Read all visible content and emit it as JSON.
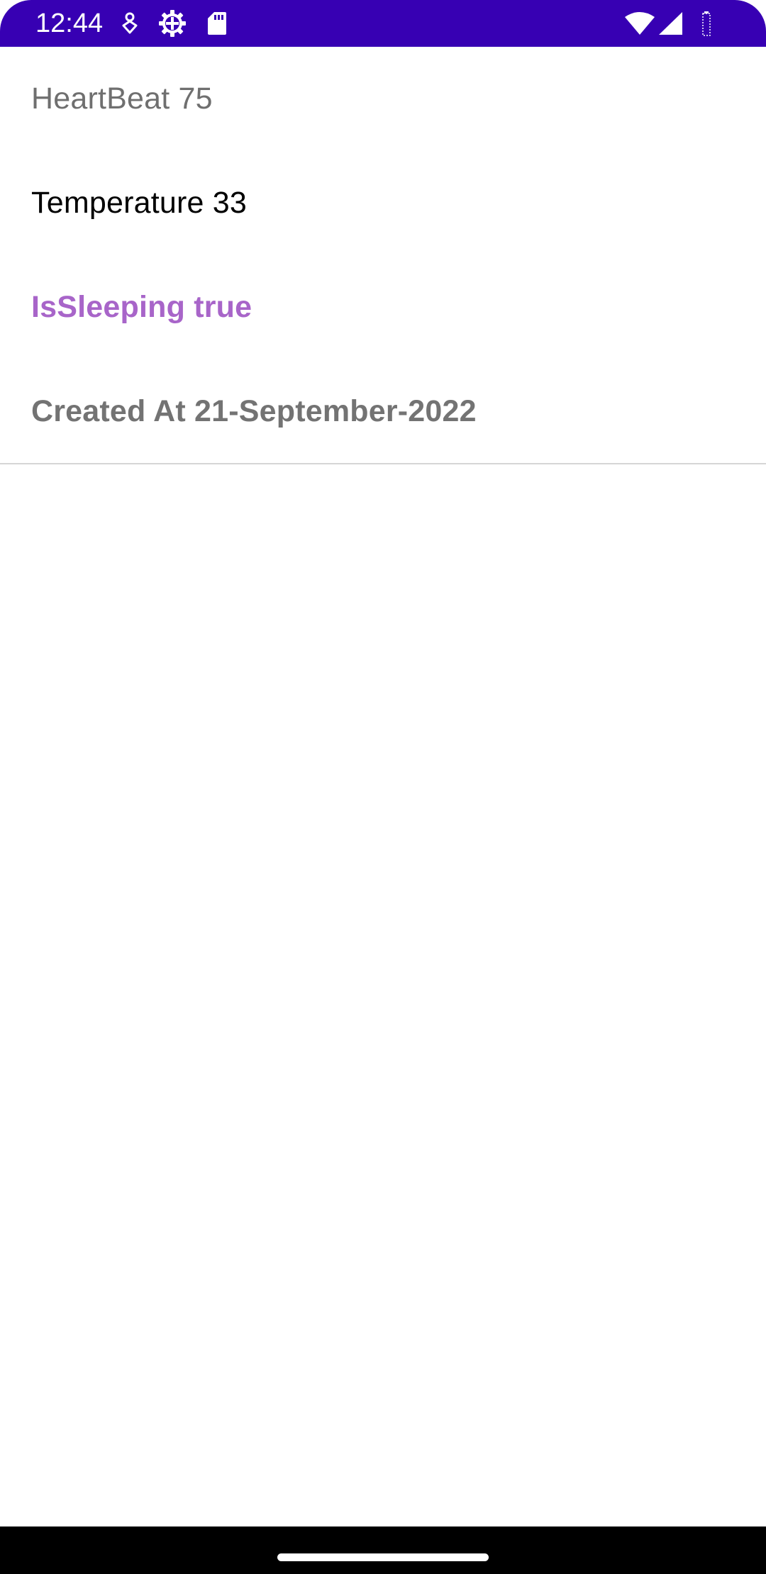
{
  "status_bar": {
    "time": "12:44",
    "background_color": "#3700b3",
    "icons": [
      "notification-icon",
      "settings-gear-icon",
      "sd-card-icon",
      "wifi-icon",
      "cell-signal-icon",
      "battery-icon"
    ]
  },
  "record": {
    "heartbeat": "HeartBeat 75",
    "temperature": "Temperature 33",
    "is_sleeping": "IsSleeping true",
    "created_at": "Created At 21-September-2022"
  },
  "colors": {
    "heartbeat_text": "#6f6f6f",
    "temperature_text": "#000000",
    "sleeping_text": "#a865c9",
    "created_text": "#737373"
  }
}
